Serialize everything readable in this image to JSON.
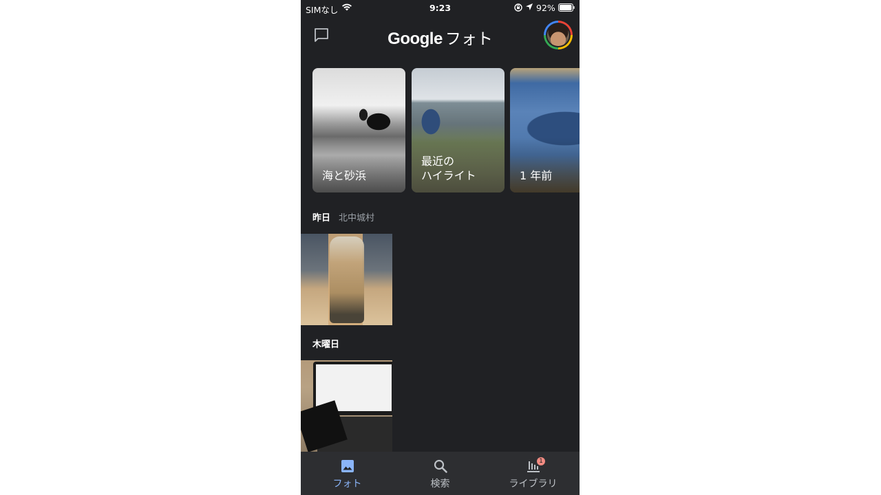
{
  "status_bar": {
    "carrier": "SIMなし",
    "time": "9:23",
    "battery": "92%"
  },
  "app_bar": {
    "title_brand": "Google",
    "title_suffix": "フォト"
  },
  "memories": [
    {
      "label": "海と砂浜"
    },
    {
      "label": "最近の\nハイライト"
    },
    {
      "label": "1 年前"
    }
  ],
  "sections": [
    {
      "day": "昨日",
      "place": "北中城村"
    },
    {
      "day": "木曜日",
      "place": ""
    }
  ],
  "bottom_nav": {
    "items": [
      {
        "label": "フォト",
        "icon": "photo-icon",
        "active": true
      },
      {
        "label": "検索",
        "icon": "search-icon",
        "active": false
      },
      {
        "label": "ライブラリ",
        "icon": "library-icon",
        "active": false,
        "badge": "1"
      }
    ]
  },
  "colors": {
    "background": "#202124",
    "active": "#8ab4f8",
    "badge": "#f28b82"
  }
}
